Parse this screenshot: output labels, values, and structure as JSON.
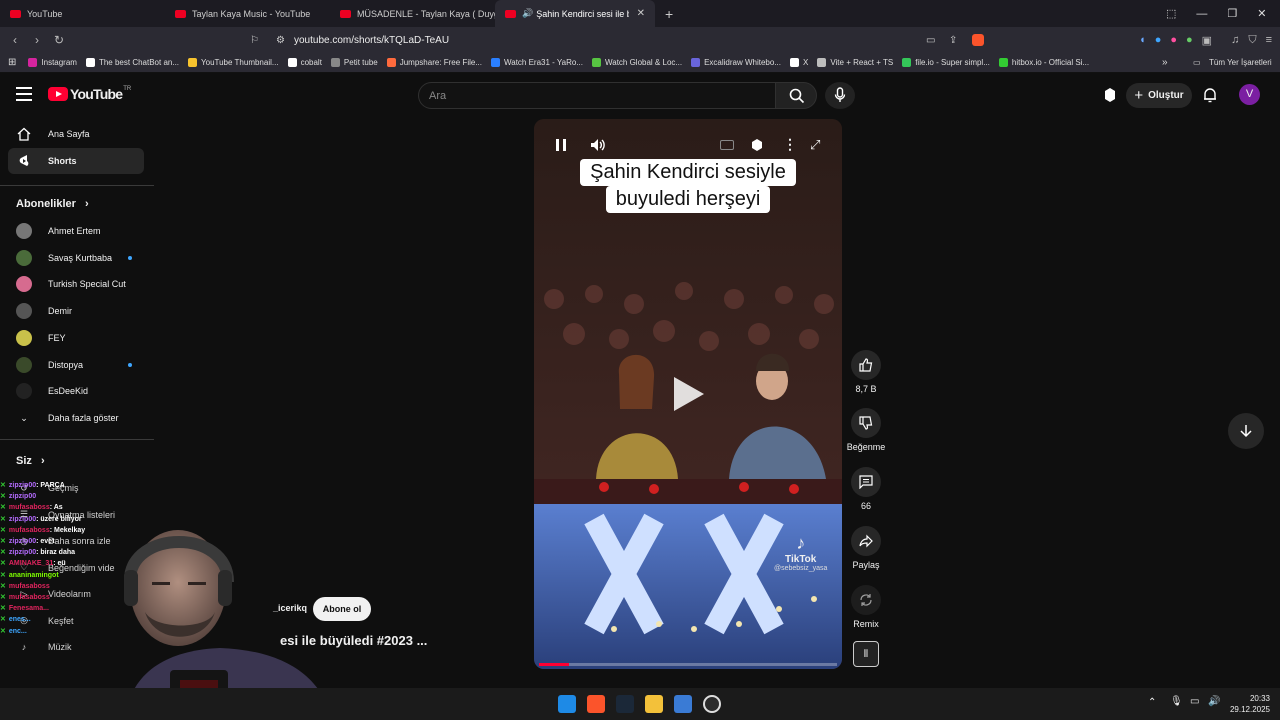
{
  "browser": {
    "tabs": [
      {
        "label": "YouTube",
        "active": false
      },
      {
        "label": "Taylan Kaya Music - YouTube",
        "active": false
      },
      {
        "label": "MÜSADENLE - Taylan Kaya ( Duygusa",
        "active": false
      },
      {
        "label": "Şahin Kendirci sesi ile büyüle",
        "active": true
      }
    ],
    "url": "youtube.com/shorts/kTQLaD-TeAU",
    "bookmarks": [
      {
        "label": "Instagram",
        "color": "#d6249f"
      },
      {
        "label": "The best ChatBot an...",
        "color": "#ffffff"
      },
      {
        "label": "YouTube Thumbnail...",
        "color": "#f7c32e"
      },
      {
        "label": "cobalt",
        "color": "#ffffff"
      },
      {
        "label": "Petit tube",
        "color": "#888888"
      },
      {
        "label": "Jumpshare: Free File...",
        "color": "#ff6a3d"
      },
      {
        "label": "Watch Era31 - YaRo...",
        "color": "#2a7fff"
      },
      {
        "label": "Watch Global & Loc...",
        "color": "#57c442"
      },
      {
        "label": "Excalidraw Whitebo...",
        "color": "#6965db"
      },
      {
        "label": "X",
        "color": "#ffffff"
      },
      {
        "label": "Vite + React + TS",
        "color": "#bdbdbd"
      },
      {
        "label": "file.io - Super simpl...",
        "color": "#34c759"
      },
      {
        "label": "hitbox.io - Official Si...",
        "color": "#33cc33"
      }
    ],
    "bookmarks_more": "»",
    "all_bookmarks": "Tüm Yer İşaretleri"
  },
  "youtube": {
    "logo_text": "YouTube",
    "logo_country": "TR",
    "search_placeholder": "Ara",
    "create_label": "Oluştur",
    "avatar_letter": "V",
    "accent": "#ff0033"
  },
  "sidebar": {
    "main": [
      {
        "label": "Ana Sayfa",
        "icon": "home-icon",
        "active": false
      },
      {
        "label": "Shorts",
        "icon": "shorts-icon",
        "active": true
      }
    ],
    "subs_header": "Abonelikler",
    "subscriptions": [
      {
        "label": "Ahmet Ertem",
        "color": "#777777",
        "dot": false
      },
      {
        "label": "Savaş Kurtbaba",
        "color": "#4a6b3a",
        "dot": true
      },
      {
        "label": "Turkish Special Cut",
        "color": "#d66b8f",
        "dot": false
      },
      {
        "label": "Demir",
        "color": "#555555",
        "dot": false
      },
      {
        "label": "FEY",
        "color": "#c9c14a",
        "dot": false
      },
      {
        "label": "Distopya",
        "color": "#3a4a2a",
        "dot": true
      },
      {
        "label": "EsDeeKid",
        "color": "#222222",
        "dot": false
      }
    ],
    "show_more": "Daha fazla göster",
    "you_header": "Siz",
    "you_items": [
      {
        "label": "Geçmiş",
        "icon": "history-icon"
      },
      {
        "label": "Oynatma listeleri",
        "icon": "playlist-icon"
      },
      {
        "label": "Daha sonra izle",
        "icon": "watch-later-icon"
      },
      {
        "label": "Beğendiğim vide",
        "icon": "liked-icon"
      },
      {
        "label": "Videolarım",
        "icon": "videos-icon"
      },
      {
        "label": "Keşfet",
        "icon": "explore-icon"
      },
      {
        "label": "Müzik",
        "icon": "music-icon"
      }
    ]
  },
  "chat": [
    {
      "user": "zipzip00",
      "color": "#b46bff",
      "msg": ": PARÇA"
    },
    {
      "user": "zipzip00",
      "color": "#b46bff",
      "msg": ""
    },
    {
      "user": "mufasaboss",
      "color": "#e0245e",
      "msg": ": As"
    },
    {
      "user": "zipzip00",
      "color": "#b46bff",
      "msg": ": üzere biliyor"
    },
    {
      "user": "mufasaboss",
      "color": "#e0245e",
      "msg": ": Mekelkay"
    },
    {
      "user": "zipzip00",
      "color": "#b46bff",
      "msg": ": evet"
    },
    {
      "user": "zipzip00",
      "color": "#b46bff",
      "msg": ": biraz daha"
    },
    {
      "user": "AMINAKE_31",
      "color": "#e0245e",
      "msg": ": eü"
    },
    {
      "user": "ananinamingot",
      "color": "#7cfc00",
      "msg": ""
    },
    {
      "user": "mufasaboss",
      "color": "#e0245e",
      "msg": ""
    },
    {
      "user": "mufasaboss",
      "color": "#e0245e",
      "msg": ""
    },
    {
      "user": "Fenesama...",
      "color": "#e0245e",
      "msg": ""
    },
    {
      "user": "enes...",
      "color": "#3ea6ff",
      "msg": ""
    },
    {
      "user": "enc...",
      "color": "#3ea6ff",
      "msg": ""
    }
  ],
  "short": {
    "caption_line1": "Şahin  Kendirci sesiyle",
    "caption_line2": "buyuledi herşeyi",
    "watermark_brand": "TikTok",
    "watermark_user": "@sebebsiz_yasa",
    "channel": "_icerikq",
    "subscribe_label": "Abone ol",
    "title": "esi ile büyüledi #2023 ...",
    "progress": 0.1
  },
  "actions": {
    "likes": "8,7 B",
    "dislike_label": "Beğenme",
    "comments": "66",
    "share_label": "Paylaş",
    "remix_label": "Remix"
  },
  "taskbar": {
    "time": "20:33",
    "date": "29.12.2025"
  }
}
